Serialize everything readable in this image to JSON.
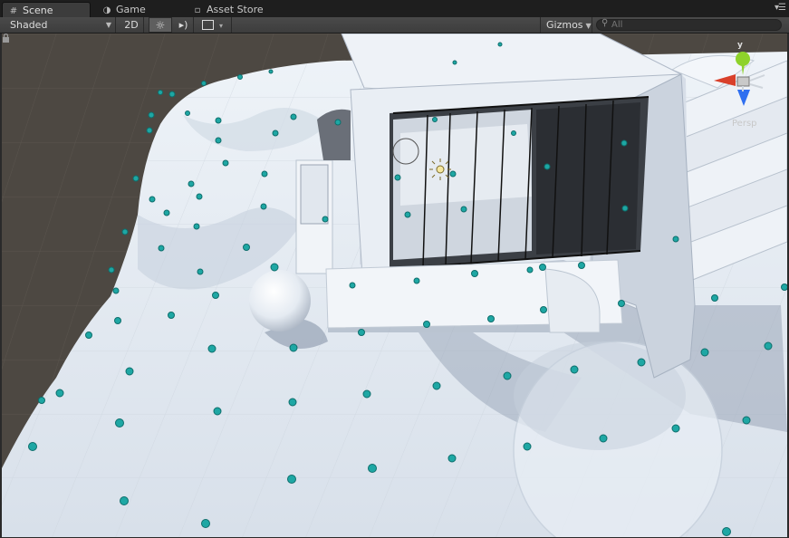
{
  "tabs": [
    {
      "label": "Scene",
      "icon": "grid-icon",
      "active": true
    },
    {
      "label": "Game",
      "icon": "pacman-icon",
      "active": false
    },
    {
      "label": "Asset Store",
      "icon": "lock-bag-icon",
      "active": false
    }
  ],
  "toolbar": {
    "shading_mode": "Shaded",
    "toggle_2d": "2D",
    "lighting_icon": "sun-icon",
    "audio_icon": "speaker-icon",
    "effects_icon": "image-icon",
    "gizmos_label": "Gizmos",
    "search_placeholder": "All"
  },
  "scene_gizmo": {
    "axis_label": "y",
    "projection_label": "Persp",
    "colors": {
      "y": "#8ed22b",
      "x": "#d9402b",
      "z": "#2f6ff0"
    }
  },
  "colors": {
    "tabbar_bg": "#1e1e1e",
    "toolbar_bg": "#444444",
    "ground": "#dfe6ee",
    "snow": "#eef3f8",
    "probe": "#1ea7a4"
  }
}
